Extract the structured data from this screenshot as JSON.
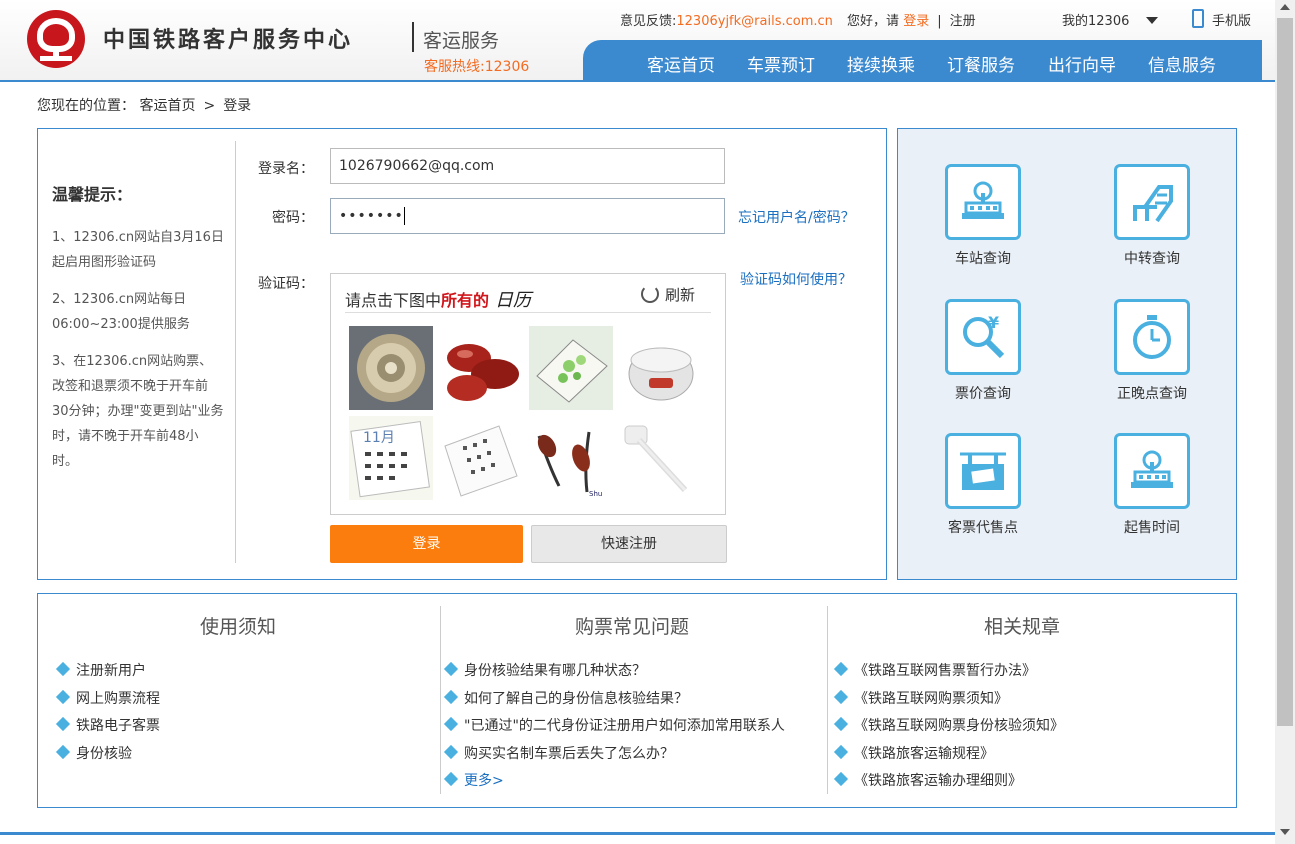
{
  "header": {
    "brand": "中国铁路客户服务中心",
    "brand_sub": "客运服务",
    "hotline": "客服热线:12306",
    "feedback_label": "意见反馈:",
    "feedback_email": "12306yjfk@rails.com.cn",
    "greeting": "您好，请",
    "login_link": "登录",
    "divider": "|",
    "register_link": "注册",
    "my12306": "我的12306",
    "mobile": "手机版",
    "nav": [
      "客运首页",
      "车票预订",
      "接续换乘",
      "订餐服务",
      "出行向导",
      "信息服务"
    ]
  },
  "breadcrumb": {
    "prefix": "您现在的位置：",
    "home": "客运首页",
    "sep": ">",
    "current": "登录"
  },
  "tips": {
    "title": "温馨提示：",
    "items": [
      "1、12306.cn网站自3月16日起启用图形验证码",
      "2、12306.cn网站每日06:00~23:00提供服务",
      "3、在12306.cn网站购票、改签和退票须不晚于开车前30分钟；办理\"变更到站\"业务时，请不晚于开车前48小时。"
    ]
  },
  "login": {
    "username_label": "登录名：",
    "username_value": "1026790662@qq.com",
    "password_label": "密码：",
    "password_value": "•••••••",
    "forgot_link": "忘记用户名/密码？",
    "captcha_label": "验证码：",
    "captcha_help_link": "验证码如何使用？",
    "captcha_prompt": "请点击下图中",
    "captcha_prompt_bold": "所有的",
    "captcha_keyword": "日历",
    "captcha_refresh": "刷新",
    "submit": "登录",
    "register": "快速注册"
  },
  "services": [
    {
      "label": "车站查询",
      "icon": "station-icon"
    },
    {
      "label": "中转查询",
      "icon": "transfer-icon"
    },
    {
      "label": "票价查询",
      "icon": "fare-search-icon"
    },
    {
      "label": "正晚点查询",
      "icon": "stopwatch-icon"
    },
    {
      "label": "客票代售点",
      "icon": "ticket-agency-icon"
    },
    {
      "label": "起售时间",
      "icon": "sale-time-icon"
    }
  ],
  "info": {
    "notice_title": "使用须知",
    "notice_items": [
      "注册新用户",
      "网上购票流程",
      "铁路电子客票",
      "身份核验"
    ],
    "faq_title": "购票常见问题",
    "faq_items": [
      "身份核验结果有哪几种状态？",
      "如何了解自己的身份信息核验结果？",
      "\"已通过\"的二代身份证注册用户如何添加常用联系人",
      "购买实名制车票后丢失了怎么办？"
    ],
    "faq_more": "更多>",
    "rules_title": "相关规章",
    "rules_items": [
      "《铁路互联网售票暂行办法》",
      "《铁路互联网购票须知》",
      "《铁路互联网购票身份核验须知》",
      "《铁路旅客运输规程》",
      "《铁路旅客运输办理细则》"
    ]
  },
  "colors": {
    "accent": "#3b8ad0",
    "orange": "#fb7d0d",
    "brand_red": "#c8161d",
    "link": "#1a6fc0",
    "icon": "#4ab0e0"
  }
}
